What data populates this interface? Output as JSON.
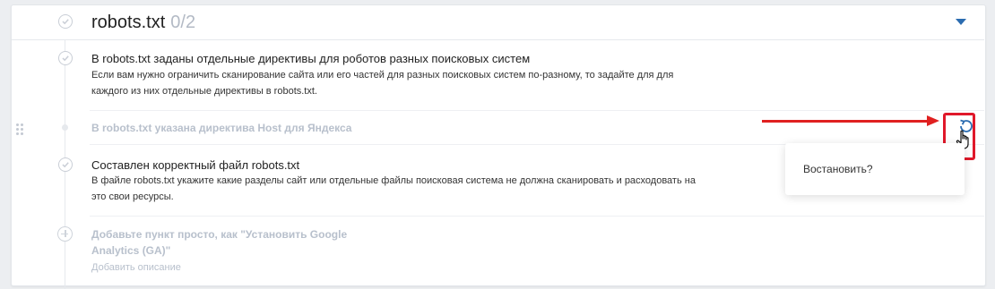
{
  "header": {
    "title": "robots.txt",
    "count": "0/2"
  },
  "items": [
    {
      "title": "В robots.txt заданы отдельные директивы для роботов разных поисковых систем",
      "desc_line1": "Если вам нужно ограничить сканирование сайта или его частей для разных поисковых систем по-разному, то задайте для для",
      "desc_line2": "каждого из них отдельные директивы в robots.txt."
    },
    {
      "title": "В robots.txt указана директива Host для Яндекса"
    },
    {
      "title": "Составлен корректный файл robots.txt",
      "desc_line1": "В файле robots.txt укажите какие разделы сайт или отдельные файлы поисковая система не должна сканировать и расходовать на",
      "desc_line2": "это свои ресурсы."
    }
  ],
  "add_item": {
    "title": "Добавьте пункт просто, как \"Установить Google Analytics (GA)\"",
    "desc": "Добавить описание"
  },
  "popup": {
    "label": "Востановить?"
  },
  "icons": {
    "check": "check-circle-icon",
    "restore": "restore-icon",
    "cursor": "hand-cursor-icon",
    "drag": "drag-handle-icon",
    "caret": "caret-down-icon",
    "add": "plus-circle-icon"
  },
  "colors": {
    "accent": "#2b6cb0",
    "annotation": "#e0182a",
    "muted_text": "#b8c0cc"
  }
}
